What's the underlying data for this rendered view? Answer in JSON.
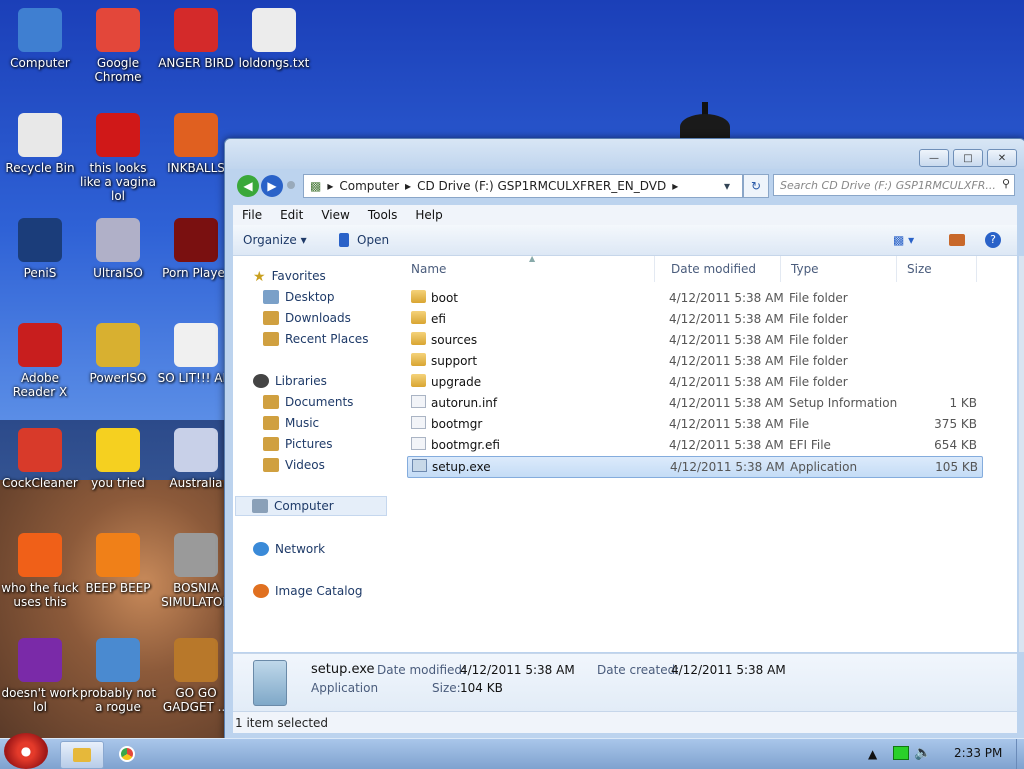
{
  "desktop": {
    "icons": [
      {
        "label": "Computer",
        "icon": "computer-icon",
        "color": "#3f7fd1"
      },
      {
        "label": "Google Chrome",
        "icon": "chrome-icon",
        "color": "#e3473a"
      },
      {
        "label": "ANGER BIRD",
        "icon": "angry-bird-icon",
        "color": "#d42a2a"
      },
      {
        "label": "loldongs.txt",
        "icon": "text-file-icon",
        "color": "#ececec"
      },
      {
        "label": "Recycle Bin",
        "icon": "recycle-bin-icon",
        "color": "#e8e8e8"
      },
      {
        "label": "this looks like a vagina lol",
        "icon": "opera-icon",
        "color": "#d01818"
      },
      {
        "label": "INKBALLS",
        "icon": "inkball-icon",
        "color": "#e06020"
      },
      {
        "label": "PeniS",
        "icon": "photoshop-icon",
        "color": "#1b3d7a"
      },
      {
        "label": "UltraISO",
        "icon": "disc-icon",
        "color": "#b0b0c8"
      },
      {
        "label": "Porn Player",
        "icon": "flash-icon",
        "color": "#7a1010"
      },
      {
        "label": "Adobe Reader X",
        "icon": "adobe-reader-icon",
        "color": "#c81e1e"
      },
      {
        "label": "PowerISO",
        "icon": "gold-disc-icon",
        "color": "#d8b030"
      },
      {
        "label": "SO LIT!!! AIR",
        "icon": "solitaire-icon",
        "color": "#f0f0f0"
      },
      {
        "label": "CockCleaner",
        "icon": "ccleaner-icon",
        "color": "#d83a2a"
      },
      {
        "label": "you tried",
        "icon": "star-icon",
        "color": "#f5d020"
      },
      {
        "label": "Australia",
        "icon": "australia-icon",
        "color": "#c8d0e8"
      },
      {
        "label": "who the fuck uses this",
        "icon": "avast-icon",
        "color": "#f06018"
      },
      {
        "label": "BEEP BEEP",
        "icon": "vlc-icon",
        "color": "#f08018"
      },
      {
        "label": "BOSNIA SIMULATOR",
        "icon": "gear-icon",
        "color": "#9a9a9a"
      },
      {
        "label": "doesn't work lol",
        "icon": "yahoo-messenger-icon",
        "color": "#7a2aa8"
      },
      {
        "label": "probably not a rogue",
        "icon": "settings-monitor-icon",
        "color": "#4a8ad0"
      },
      {
        "label": "GO GO GADGET ...",
        "icon": "briefcase-icon",
        "color": "#b8782a"
      }
    ]
  },
  "window": {
    "address": {
      "crumbs": [
        "Computer",
        "CD Drive (F:) GSP1RMCULXFRER_EN_DVD"
      ]
    },
    "search_placeholder": "Search CD Drive (F:) GSP1RMCULXFR...",
    "menu": [
      "File",
      "Edit",
      "View",
      "Tools",
      "Help"
    ],
    "toolbar": {
      "organize": "Organize",
      "open": "Open"
    },
    "nav": {
      "favorites": "Favorites",
      "desktop": "Desktop",
      "downloads": "Downloads",
      "recent": "Recent Places",
      "libraries": "Libraries",
      "documents": "Documents",
      "music": "Music",
      "pictures": "Pictures",
      "videos": "Videos",
      "computer": "Computer",
      "network": "Network",
      "image_catalog": "Image Catalog"
    },
    "columns": {
      "name": "Name",
      "date": "Date modified",
      "type": "Type",
      "size": "Size"
    },
    "files": [
      {
        "name": "boot",
        "date": "4/12/2011 5:38 AM",
        "type": "File folder",
        "size": "",
        "kind": "folder"
      },
      {
        "name": "efi",
        "date": "4/12/2011 5:38 AM",
        "type": "File folder",
        "size": "",
        "kind": "folder"
      },
      {
        "name": "sources",
        "date": "4/12/2011 5:38 AM",
        "type": "File folder",
        "size": "",
        "kind": "folder"
      },
      {
        "name": "support",
        "date": "4/12/2011 5:38 AM",
        "type": "File folder",
        "size": "",
        "kind": "folder"
      },
      {
        "name": "upgrade",
        "date": "4/12/2011 5:38 AM",
        "type": "File folder",
        "size": "",
        "kind": "folder"
      },
      {
        "name": "autorun.inf",
        "date": "4/12/2011 5:38 AM",
        "type": "Setup Information",
        "size": "1 KB",
        "kind": "file"
      },
      {
        "name": "bootmgr",
        "date": "4/12/2011 5:38 AM",
        "type": "File",
        "size": "375 KB",
        "kind": "file"
      },
      {
        "name": "bootmgr.efi",
        "date": "4/12/2011 5:38 AM",
        "type": "EFI File",
        "size": "654 KB",
        "kind": "file"
      },
      {
        "name": "setup.exe",
        "date": "4/12/2011 5:38 AM",
        "type": "Application",
        "size": "105 KB",
        "kind": "exe"
      }
    ],
    "details": {
      "name": "setup.exe",
      "kind": "Application",
      "modified_label": "Date modified:",
      "modified": "4/12/2011 5:38 AM",
      "created_label": "Date created:",
      "created": "4/12/2011 5:38 AM",
      "size_label": "Size:",
      "size": "104 KB"
    },
    "status": "1 item selected"
  },
  "taskbar": {
    "clock": "2:33 PM"
  }
}
